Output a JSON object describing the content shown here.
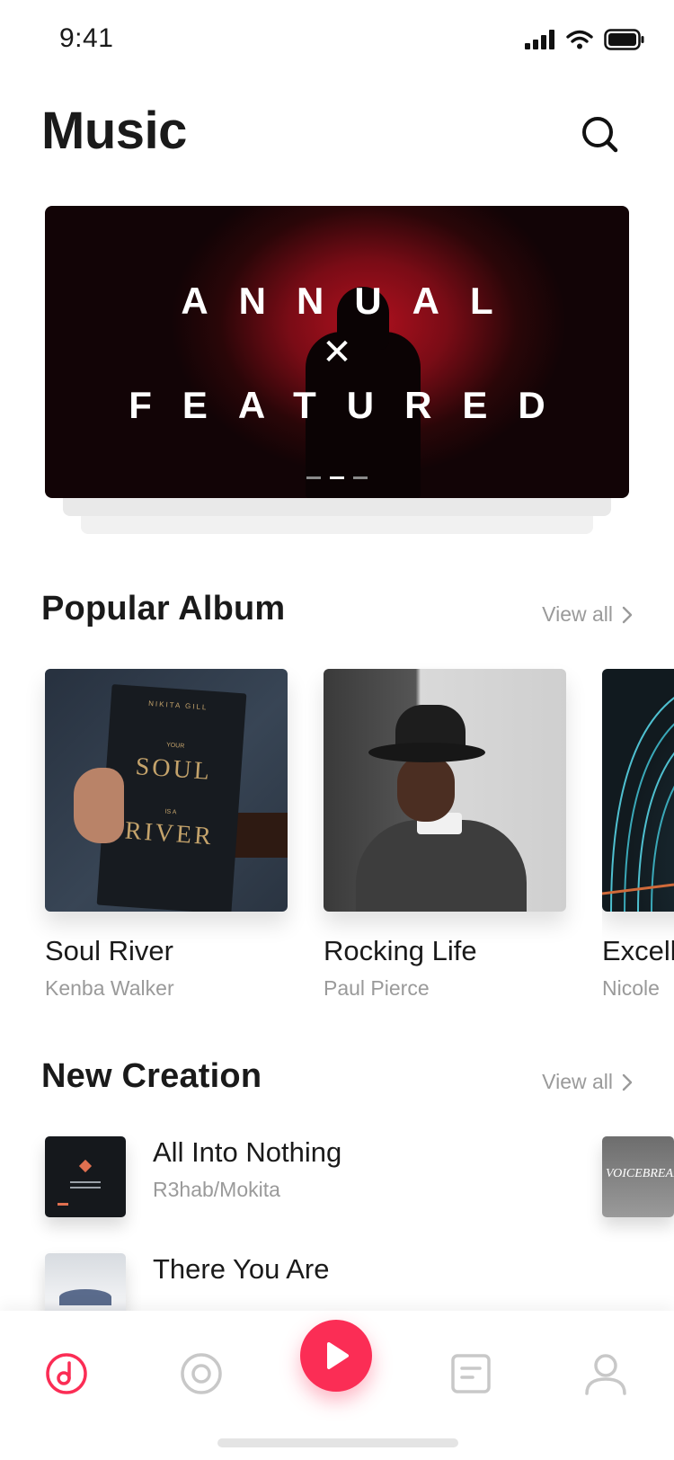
{
  "status": {
    "time": "9:41"
  },
  "header": {
    "title": "Music"
  },
  "banner": {
    "line1": "ANNUAL",
    "xmark": "✕",
    "line2": "FEATURED"
  },
  "popular": {
    "title": "Popular Album",
    "view_all": "View all",
    "albums": [
      {
        "title": "Soul River",
        "artist": "Kenba Walker",
        "cover_author": "NIKITA GILL",
        "cover_your": "YOUR",
        "cover_soul": "SOUL",
        "cover_isa": "IS A",
        "cover_river": "RIVER"
      },
      {
        "title": "Rocking Life",
        "artist": "Paul Pierce"
      },
      {
        "title": "Excell",
        "artist": "Nicole"
      }
    ]
  },
  "creation": {
    "title": "New Creation",
    "view_all": "View all",
    "items": [
      {
        "name": "All Into Nothing",
        "artist": "R3hab/Mokita"
      },
      {
        "name": "There You Are",
        "artist": ""
      }
    ],
    "side_thumb_text": "VOICEBREAK"
  },
  "colors": {
    "accent": "#fb2d55",
    "muted": "#9a9a9a"
  }
}
